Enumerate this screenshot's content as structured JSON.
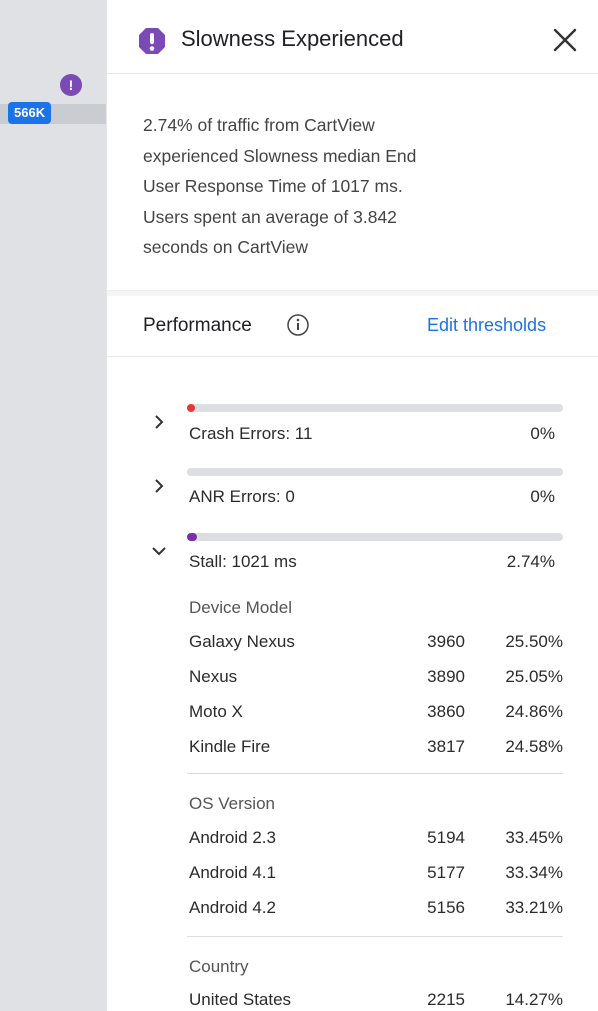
{
  "sidebar": {
    "count_badge": "566K",
    "alert_glyph": "!"
  },
  "header": {
    "title": "Slowness Experienced",
    "icon": "exclamation-hexagon-icon",
    "icon_color": "#7b4bb5",
    "close_icon": "close-icon"
  },
  "summary": {
    "lines": [
      "2.74% of traffic from CartView",
      "experienced Slowness median End",
      "User Response Time of 1017 ms.",
      "Users spent an average of 3.842",
      "seconds on CartView"
    ]
  },
  "performance": {
    "title": "Performance",
    "edit_link": "Edit thresholds",
    "rows": [
      {
        "label": "Crash Errors: 11",
        "pct": "0%",
        "expanded": false,
        "fill_fraction": 0.0,
        "color": "#e53935"
      },
      {
        "label": "ANR Errors: 0",
        "pct": "0%",
        "expanded": false,
        "fill_fraction": 0.0,
        "color": "#9e9e9e"
      },
      {
        "label": "Stall: 1021 ms",
        "pct": "2.74%",
        "expanded": true,
        "fill_fraction": 0.0274,
        "color": "#7b2fa8"
      }
    ],
    "breakdown": {
      "device_model": {
        "title": "Device Model",
        "items": [
          {
            "name": "Galaxy Nexus",
            "count": "3960",
            "pct": "25.50%"
          },
          {
            "name": "Nexus",
            "count": "3890",
            "pct": "25.05%"
          },
          {
            "name": "Moto X",
            "count": "3860",
            "pct": "24.86%"
          },
          {
            "name": "Kindle Fire",
            "count": "3817",
            "pct": "24.58%"
          }
        ]
      },
      "os_version": {
        "title": "OS Version",
        "items": [
          {
            "name": "Android 2.3",
            "count": "5194",
            "pct": "33.45%"
          },
          {
            "name": "Android 4.1",
            "count": "5177",
            "pct": "33.34%"
          },
          {
            "name": "Android 4.2",
            "count": "5156",
            "pct": "33.21%"
          }
        ]
      },
      "country": {
        "title": "Country",
        "items": [
          {
            "name": "United States",
            "count": "2215",
            "pct": "14.27%"
          }
        ]
      }
    }
  },
  "colors": {
    "accent": "#1a73e8",
    "alert_purple": "#7b4bb5",
    "crash_red": "#e53935",
    "stall_purple": "#7b2fa8"
  }
}
